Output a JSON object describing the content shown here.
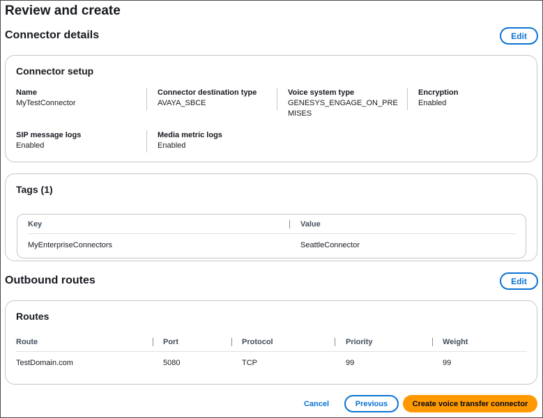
{
  "page": {
    "title": "Review and create"
  },
  "connector_details": {
    "heading": "Connector details",
    "edit_label": "Edit",
    "setup": {
      "title": "Connector setup",
      "fields": [
        {
          "label": "Name",
          "value": "MyTestConnector"
        },
        {
          "label": "Connector destination type",
          "value": "AVAYA_SBCE"
        },
        {
          "label": "Voice system type",
          "value_line1": "GENESYS_ENGAGE_ON_PRE",
          "value_line2": "MISES"
        },
        {
          "label": "Encryption",
          "value": "Enabled"
        },
        {
          "label": "SIP message logs",
          "value": "Enabled"
        },
        {
          "label": "Media metric logs",
          "value": "Enabled"
        }
      ]
    },
    "tags": {
      "title": "Tags (1)",
      "columns": [
        "Key",
        "Value"
      ],
      "rows": [
        {
          "key": "MyEnterpriseConnectors",
          "value": "SeattleConnector"
        }
      ]
    }
  },
  "outbound_routes": {
    "heading": "Outbound routes",
    "edit_label": "Edit",
    "routes": {
      "title": "Routes",
      "columns": [
        "Route",
        "Port",
        "Protocol",
        "Priority",
        "Weight"
      ],
      "rows": [
        {
          "route": "TestDomain.com",
          "port": "5080",
          "protocol": "TCP",
          "priority": "99",
          "weight": "99"
        }
      ]
    }
  },
  "footer": {
    "cancel_label": "Cancel",
    "previous_label": "Previous",
    "create_label": "Create voice transfer connector"
  },
  "colors": {
    "accent": "#0972d3",
    "primary_button": "#ff9900",
    "border": "#c6c6cd"
  }
}
